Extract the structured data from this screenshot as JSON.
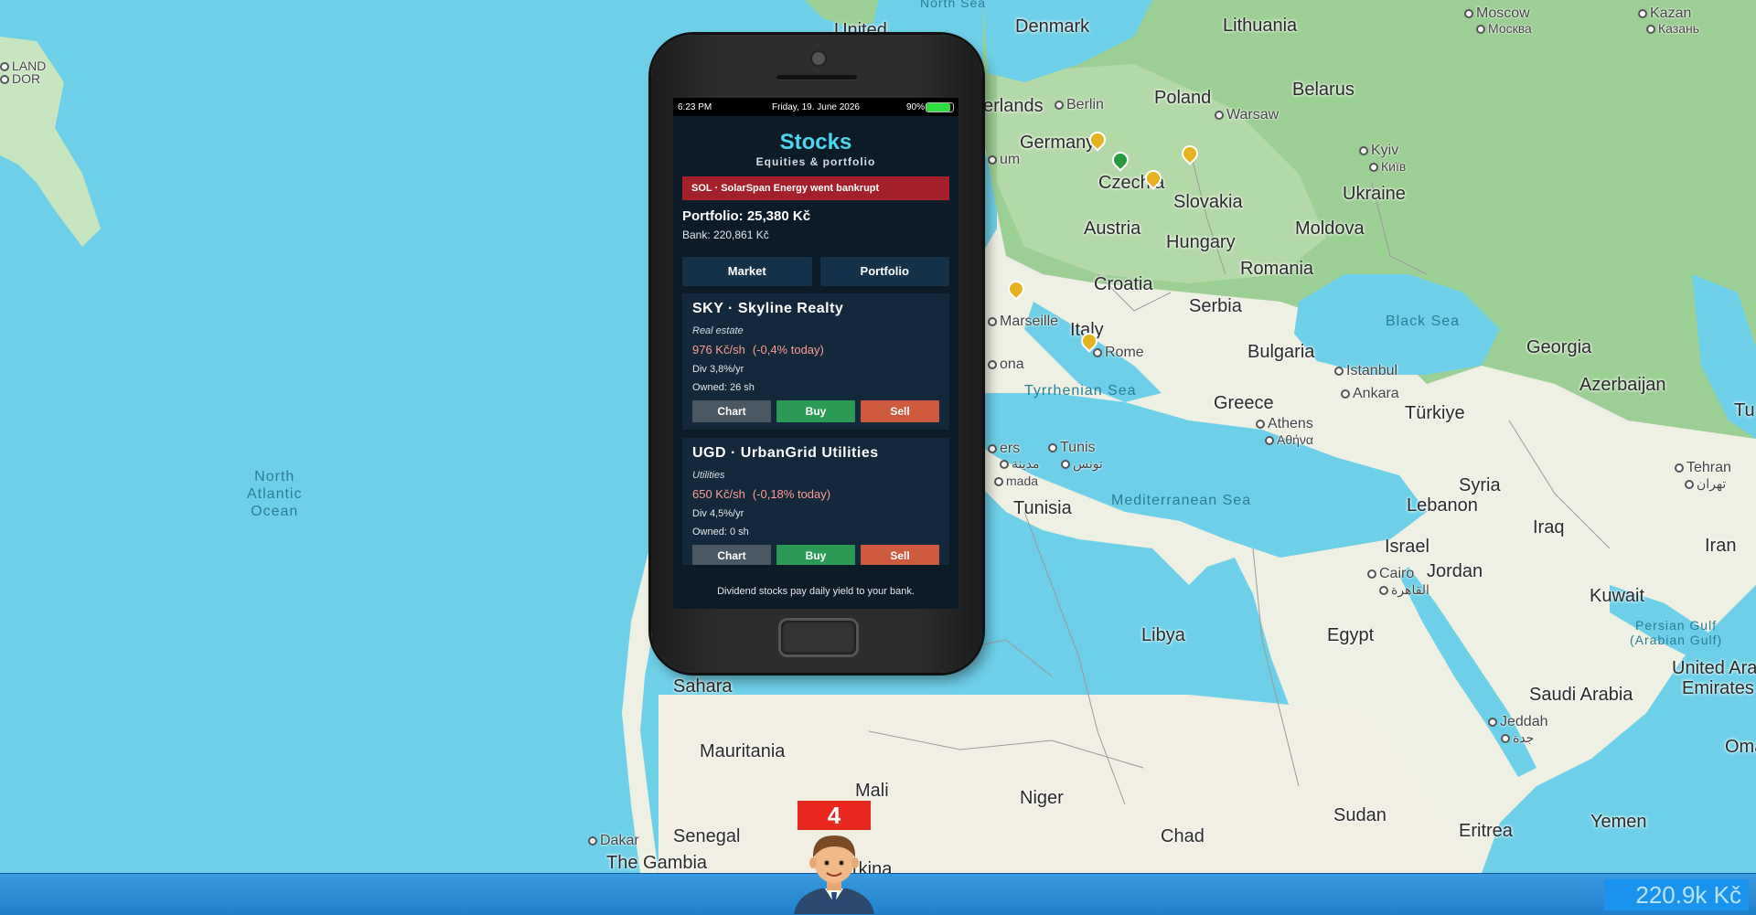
{
  "map": {
    "seas": [
      {
        "name": "North Atlantic Ocean",
        "lines": [
          "North",
          "Atlantic",
          "Ocean"
        ]
      },
      {
        "name": "Black Sea"
      },
      {
        "name": "Tyrrhenian Sea"
      },
      {
        "name": "Mediterranean Sea"
      },
      {
        "name": "Persian Gulf (Arabian Gulf)",
        "lines": [
          "Persian Gulf",
          "(Arabian Gulf)"
        ]
      }
    ],
    "countries": [
      "Denmark",
      "Lithuania",
      "Poland",
      "Belarus",
      "Germany",
      "Czechia",
      "Slovakia",
      "Ukraine",
      "Austria",
      "Hungary",
      "Moldova",
      "Romania",
      "Croatia",
      "Serbia",
      "Italy",
      "Bulgaria",
      "Georgia",
      "Azerbaijan",
      "Greece",
      "Türkiye",
      "Tunisia",
      "Syria",
      "Lebanon",
      "Iraq",
      "Israel",
      "Jordan",
      "Iran",
      "Kuwait",
      "Libya",
      "Egypt",
      "Saudi Arabia",
      "United Ara",
      "Emirates",
      "Sahara",
      "Mauritania",
      "Mali",
      "Niger",
      "Chad",
      "Sudan",
      "Eritrea",
      "Yemen",
      "Oma",
      "Senegal",
      "The Gambia",
      "erlands",
      "United",
      "rkina",
      "Tu"
    ],
    "cities": [
      "Berlin",
      "Warsaw",
      "Kyiv",
      "Київ",
      "Moscow",
      "Москва",
      "Kazan",
      "Казань",
      "Marseille",
      "Rome",
      "Istanbul",
      "Ankara",
      "Athens",
      "Αθήνα",
      "Tunis",
      "تونس",
      "Cairo",
      "القاهرة",
      "Jeddah",
      "جدة",
      "Tehran",
      "تهران",
      "Dakar",
      "mada",
      "ona",
      "ers",
      "مدينة",
      "um",
      "LAND",
      "DOR",
      "North Sea"
    ]
  },
  "phone": {
    "status": {
      "time": "6:23 PM",
      "date": "Friday, 19. June 2026",
      "battery_label": "90%",
      "battery_level": 0.9
    },
    "app": {
      "title": "Stocks",
      "subtitle": "Equities & portfolio",
      "alert": "SOL · SolarSpan Energy went bankrupt",
      "portfolio": "Portfolio: 25,380 Kč",
      "bank": "Bank: 220,861 Kč",
      "tabs": [
        {
          "label": "Market"
        },
        {
          "label": "Portfolio"
        }
      ],
      "stocks": [
        {
          "name": "SKY · Skyline Realty",
          "sector": "Real estate",
          "price": "976 Kč/sh",
          "change": "(-0,4% today)",
          "dividend": "Div 3,8%/yr",
          "owned": "Owned: 26 sh",
          "chart": "Chart",
          "buy": "Buy",
          "sell": "Sell"
        },
        {
          "name": "UGD · UrbanGrid Utilities",
          "sector": "Utilities",
          "price": "650 Kč/sh",
          "change": "(-0,18% today)",
          "dividend": "Div 4,5%/yr",
          "owned": "Owned: 0 sh",
          "chart": "Chart",
          "buy": "Buy",
          "sell": "Sell"
        }
      ],
      "footer": "Dividend stocks pay daily yield to your bank."
    }
  },
  "player": {
    "level": "4",
    "money": "220.9k Kč"
  },
  "colors": {
    "water": "#6ed0e8",
    "land": "#f2efe6",
    "accent": "#4fd6ee",
    "alert": "#a4202a",
    "buy": "#2b9a54",
    "sell": "#cd5a3f",
    "taskbar": "#1f7fcb"
  }
}
